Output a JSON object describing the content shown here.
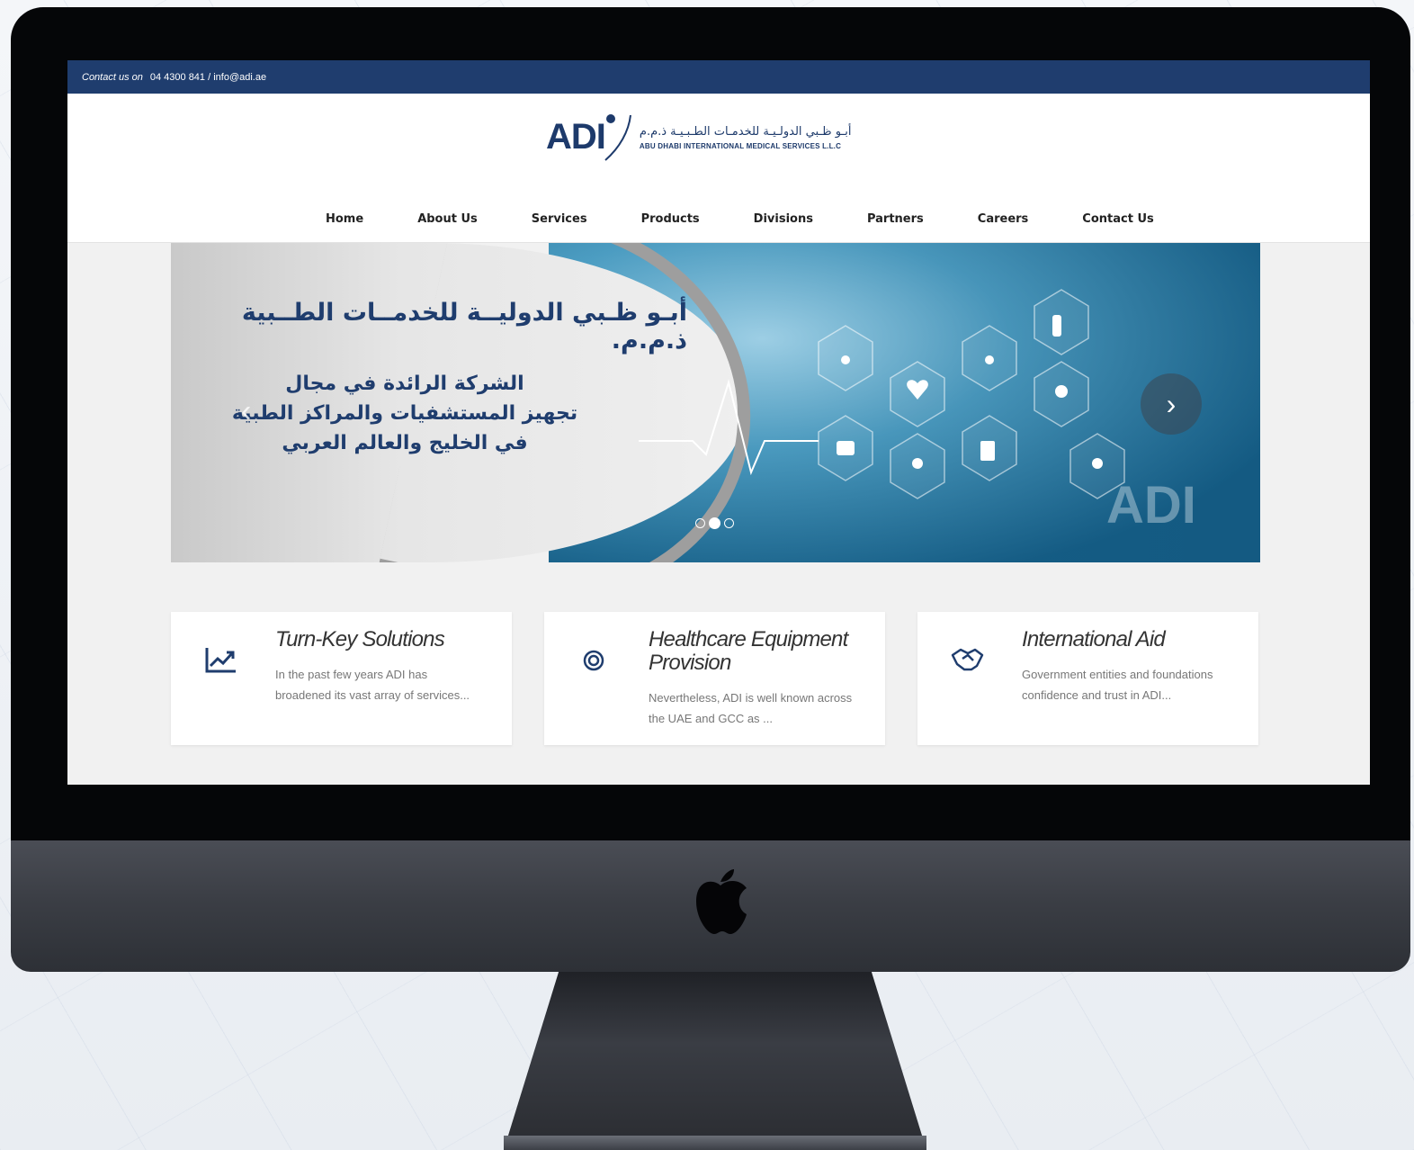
{
  "topbar": {
    "contact_label": "Contact us on",
    "contact_value": "04 4300 841 / info@adi.ae"
  },
  "logo": {
    "mark": "ADI",
    "arabic_name": "أبـو ظـبي الدولـيـة للخدمـات الطـبـيـة ذ.م.م",
    "english_name": "ABU DHABI INTERNATIONAL MEDICAL SERVICES L.L.C"
  },
  "nav": {
    "items": [
      {
        "label": "Home"
      },
      {
        "label": "About Us"
      },
      {
        "label": "Services"
      },
      {
        "label": "Products"
      },
      {
        "label": "Divisions"
      },
      {
        "label": "Partners"
      },
      {
        "label": "Careers"
      },
      {
        "label": "Contact Us"
      }
    ]
  },
  "hero": {
    "title_ar": "أبـو ظـبي الدوليــة للخدمــات الطــبية ذ.م.م.",
    "line1_ar": "الشركة الرائدة في مجال",
    "line2_ar": "تجهيز المستشفيات والمراكز الطبية",
    "line3_ar": "في الخليج والعالم العربي",
    "watermark": "ADI",
    "active_slide": 2,
    "slide_count": 3,
    "prev_icon": "chevron-left-icon",
    "next_icon": "chevron-right-icon"
  },
  "cards": [
    {
      "icon": "trending-up-icon",
      "title": "Turn-Key Solutions",
      "desc": "In the past few years ADI has broadened its vast array of services..."
    },
    {
      "icon": "target-icon",
      "title": "Healthcare Equipment Provision",
      "desc": "Nevertheless, ADI is well known across the UAE and GCC as ..."
    },
    {
      "icon": "handshake-icon",
      "title": "International Aid",
      "desc": "Government entities and foundations confidence and trust in ADI..."
    }
  ],
  "colors": {
    "brand_navy": "#1f3d6e",
    "hero_blue": "#1c6f9a"
  }
}
